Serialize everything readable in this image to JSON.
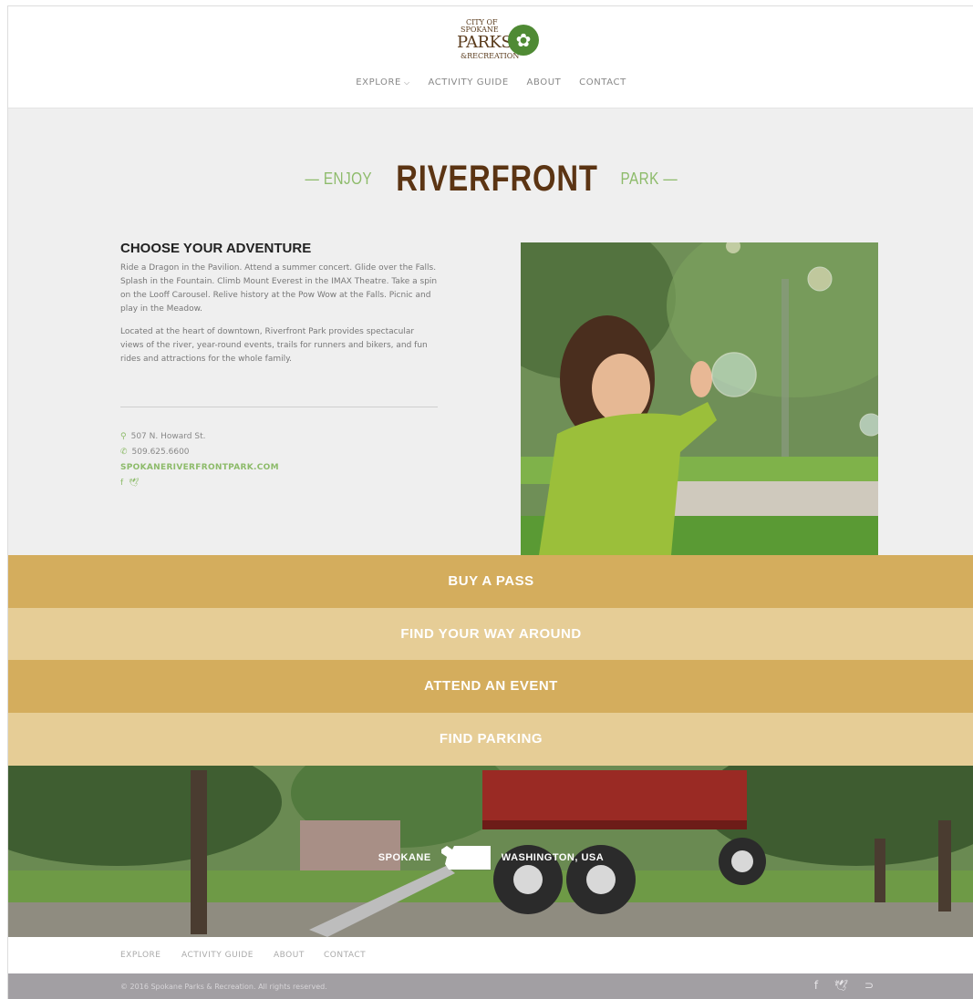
{
  "logo": {
    "line1": "CITY OF",
    "line2": "SPOKANE",
    "line3": "PARKS",
    "line4": "&RECREATION",
    "icon": "leaf-icon"
  },
  "nav": {
    "items": [
      "EXPLORE",
      "ACTIVITY GUIDE",
      "ABOUT",
      "CONTACT"
    ]
  },
  "hero": {
    "pre": "— ENJOY",
    "title": "RIVERFRONT",
    "post": "PARK —"
  },
  "adventure": {
    "heading": "CHOOSE YOUR ADVENTURE",
    "p1": "Ride a Dragon in the Pavilion. Attend a summer concert. Glide over the Falls. Splash in the Fountain. Climb Mount Everest in the IMAX Theatre. Take a spin on the Looff Carousel. Relive history at the Pow Wow at the Falls. Picnic and play in the Meadow.",
    "p2": "Located at the heart of downtown, Riverfront Park provides spectacular views of the river, year-round events, trails for runners and bikers, and fun rides and attractions for the whole family."
  },
  "contact": {
    "address": "507 N. Howard St.",
    "phone": "509.625.6600",
    "website": "SPOKANERIVERFRONTPARK.COM",
    "social": [
      "f",
      "twitter-icon"
    ]
  },
  "bands": {
    "b1": "BUY A PASS",
    "b2": "FIND YOUR WAY AROUND",
    "b3": "ATTEND AN EVENT",
    "b4": "FIND PARKING"
  },
  "location": {
    "left": "SPOKANE",
    "right": "WASHINGTON, USA"
  },
  "footer": {
    "nav": [
      "EXPLORE",
      "ACTIVITY GUIDE",
      "ABOUT",
      "CONTACT"
    ],
    "copyright": "© 2016 Spokane Parks & Recreation. All rights reserved.",
    "social": [
      "facebook-icon",
      "twitter-icon",
      "rss-icon"
    ]
  },
  "colors": {
    "brown": "#5b3413",
    "green": "#8dbb6a",
    "gold": "#d4ad5d",
    "gold_light": "#e6cd96",
    "footer_bar": "#a29fa3"
  }
}
